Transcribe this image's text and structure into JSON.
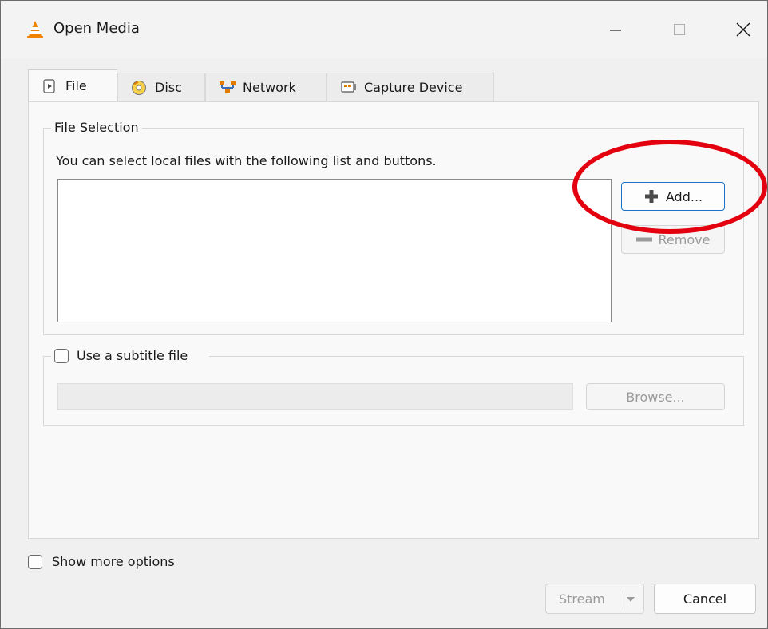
{
  "window": {
    "title": "Open Media",
    "icon": "vlc-cone-icon",
    "controls": {
      "minimize": "minimize-icon",
      "maximize": "maximize-icon",
      "close": "close-icon"
    }
  },
  "tabs": [
    {
      "label": "File",
      "mnemonic": "F",
      "icon": "file-play-icon",
      "active": true
    },
    {
      "label": "Disc",
      "mnemonic": "D",
      "icon": "disc-icon",
      "active": false
    },
    {
      "label": "Network",
      "mnemonic": "N",
      "icon": "network-icon",
      "active": false
    },
    {
      "label": "Capture Device",
      "mnemonic": "D",
      "icon": "capture-device-icon",
      "active": false
    }
  ],
  "file_selection": {
    "group_title": "File Selection",
    "hint": "You can select local files with the following list and buttons.",
    "files": [],
    "add_label": "Add...",
    "remove_label": "Remove"
  },
  "subtitle": {
    "checkbox_label": "Use a subtitle file",
    "checked": false,
    "path_value": "",
    "browse_label": "Browse..."
  },
  "options": {
    "show_more_label": "Show more options",
    "checked": false
  },
  "footer": {
    "stream_label": "Stream",
    "cancel_label": "Cancel"
  },
  "colors": {
    "annotation": "#e3000f",
    "accent": "#1a73c8",
    "vlc_orange": "#f08300"
  }
}
